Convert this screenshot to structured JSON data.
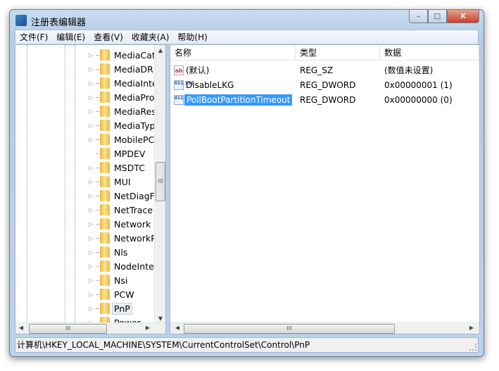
{
  "window": {
    "title": "注册表编辑器",
    "controls": {
      "minimize": "–",
      "maximize": "□",
      "close": "X"
    }
  },
  "menu": [
    "文件(F)",
    "编辑(E)",
    "查看(V)",
    "收藏夹(A)",
    "帮助(H)"
  ],
  "tree": {
    "items": [
      {
        "label": "MediaCat",
        "expandable": true
      },
      {
        "label": "MediaDRM",
        "expandable": true
      },
      {
        "label": "MediaInte",
        "expandable": true
      },
      {
        "label": "MediaPro",
        "expandable": true
      },
      {
        "label": "MediaRes",
        "expandable": true
      },
      {
        "label": "MediaTyp",
        "expandable": true
      },
      {
        "label": "MobilePC",
        "expandable": true
      },
      {
        "label": "MPDEV",
        "expandable": false
      },
      {
        "label": "MSDTC",
        "expandable": true
      },
      {
        "label": "MUI",
        "expandable": true
      },
      {
        "label": "NetDiagFx",
        "expandable": true
      },
      {
        "label": "NetTrace",
        "expandable": true
      },
      {
        "label": "Network",
        "expandable": true
      },
      {
        "label": "NetworkP",
        "expandable": true
      },
      {
        "label": "Nls",
        "expandable": true
      },
      {
        "label": "NodeInter",
        "expandable": true
      },
      {
        "label": "Nsi",
        "expandable": true
      },
      {
        "label": "PCW",
        "expandable": true
      },
      {
        "label": "PnP",
        "expandable": true,
        "selected": true
      },
      {
        "label": "Power",
        "expandable": true
      }
    ]
  },
  "list": {
    "columns": [
      "名称",
      "类型",
      "数据"
    ],
    "rows": [
      {
        "icon": "string-value-icon",
        "icon_text": "ab",
        "name": "(默认)",
        "type": "REG_SZ",
        "data": "(数值未设置)"
      },
      {
        "icon": "binary-value-icon",
        "icon_text": "011 110",
        "name": "DisableLKG",
        "type": "REG_DWORD",
        "data": "0x00000001 (1)"
      },
      {
        "icon": "binary-value-icon",
        "icon_text": "011 110",
        "name": "PollBootPartitionTimeout",
        "type": "REG_DWORD",
        "data": "0x00000000 (0)",
        "selected": true
      }
    ]
  },
  "scroll_glyph": "III",
  "status": "计算机\\HKEY_LOCAL_MACHINE\\SYSTEM\\CurrentControlSet\\Control\\PnP",
  "colors": {
    "selection": "#3399ff",
    "title_gradient": "#c8dcf0",
    "close_button": "#c4412a"
  }
}
